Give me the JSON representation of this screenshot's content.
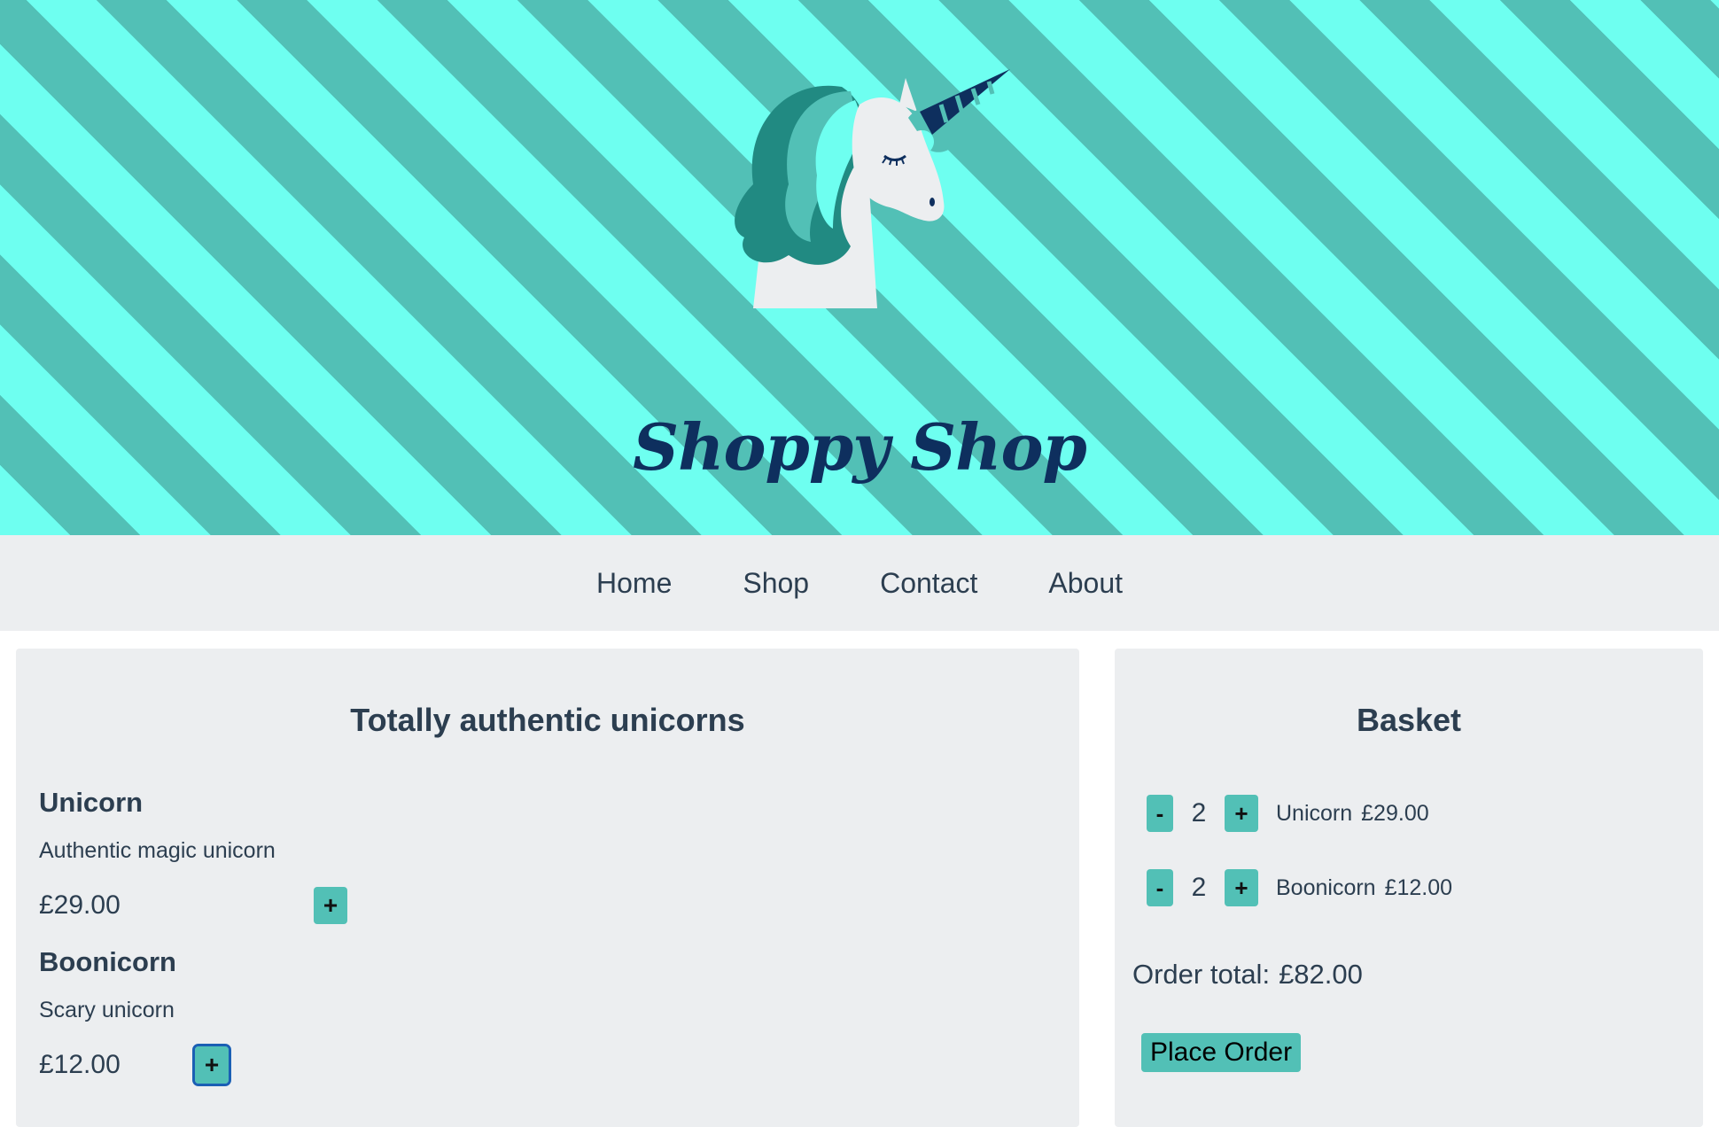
{
  "header": {
    "site_title": "Shoppy Shop",
    "logo_icon": "unicorn-head-icon"
  },
  "nav": {
    "items": [
      {
        "label": "Home"
      },
      {
        "label": "Shop"
      },
      {
        "label": "Contact"
      },
      {
        "label": "About"
      }
    ]
  },
  "shop": {
    "title": "Totally authentic unicorns",
    "products": [
      {
        "name": "Unicorn",
        "description": "Authentic magic unicorn",
        "price": "£29.00",
        "add_label": "+"
      },
      {
        "name": "Boonicorn",
        "description": "Scary unicorn",
        "price": "£12.00",
        "add_label": "+"
      }
    ]
  },
  "basket": {
    "title": "Basket",
    "items": [
      {
        "minus_label": "-",
        "quantity": "2",
        "plus_label": "+",
        "name": "Unicorn",
        "price": "£29.00"
      },
      {
        "minus_label": "-",
        "quantity": "2",
        "plus_label": "+",
        "name": "Boonicorn",
        "price": "£12.00"
      }
    ],
    "order_total_label": "Order total:",
    "order_total_value": "£82.00",
    "place_order_label": "Place Order"
  },
  "colors": {
    "stripe_light": "#6efff0",
    "stripe_dark": "#52c0b6",
    "title_navy": "#0e2f5e",
    "button_teal": "#52c0b6",
    "panel_bg": "#eceef0",
    "text": "#2c3e50"
  }
}
